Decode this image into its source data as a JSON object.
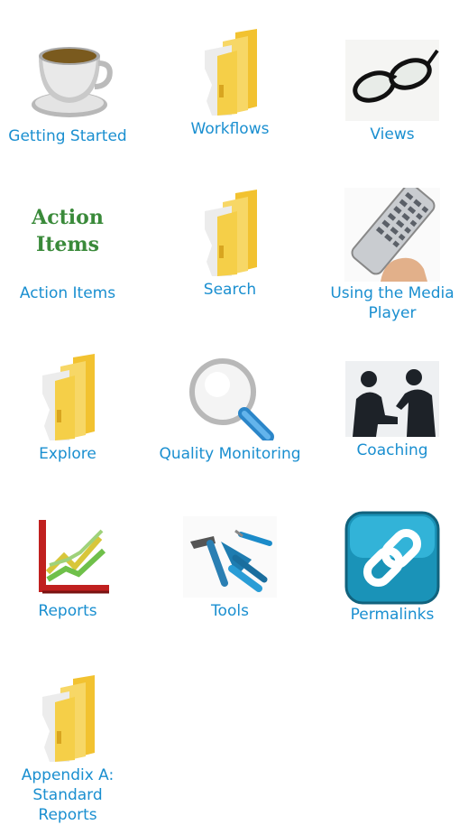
{
  "tiles": [
    {
      "label": "Getting Started",
      "icon": "coffee-cup-icon"
    },
    {
      "label": "Workflows",
      "icon": "folder-icon"
    },
    {
      "label": "Views",
      "icon": "eyeglasses-icon"
    },
    {
      "label": "Action Items",
      "icon": "action-items-text-icon",
      "icon_text_line1": "Action",
      "icon_text_line2": "Items"
    },
    {
      "label": "Search",
      "icon": "folder-icon"
    },
    {
      "label": "Using the Media Player",
      "icon": "remote-control-icon"
    },
    {
      "label": "Explore",
      "icon": "folder-icon"
    },
    {
      "label": "Quality Monitoring",
      "icon": "magnifying-glass-icon"
    },
    {
      "label": "Coaching",
      "icon": "coaching-people-icon"
    },
    {
      "label": "Reports",
      "icon": "chart-icon"
    },
    {
      "label": "Tools",
      "icon": "tools-icon"
    },
    {
      "label": "Permalinks",
      "icon": "chain-link-icon"
    },
    {
      "label": "Appendix A: Standard Reports",
      "icon": "folder-icon"
    }
  ],
  "colors": {
    "link": "#1a8fd0",
    "action_items_green": "#3a8a3a"
  }
}
